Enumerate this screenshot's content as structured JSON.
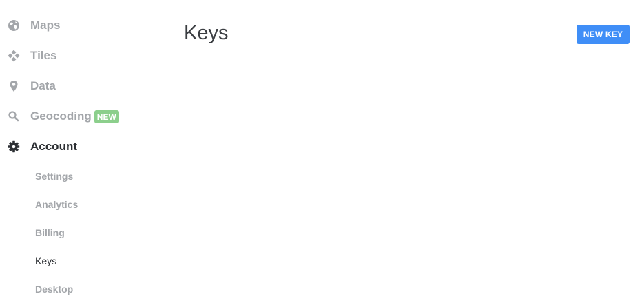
{
  "sidebar": {
    "items": [
      {
        "label": "Maps",
        "icon": "globe-icon"
      },
      {
        "label": "Tiles",
        "icon": "tiles-icon"
      },
      {
        "label": "Data",
        "icon": "map-pin-icon"
      },
      {
        "label": "Geocoding",
        "icon": "search-icon",
        "badge": "NEW"
      },
      {
        "label": "Account",
        "icon": "gear-icon",
        "active": true
      }
    ],
    "subitems": [
      {
        "label": "Settings"
      },
      {
        "label": "Analytics"
      },
      {
        "label": "Billing"
      },
      {
        "label": "Keys",
        "active": true
      },
      {
        "label": "Desktop"
      }
    ]
  },
  "main": {
    "title": "Keys",
    "new_key_label": "NEW KEY"
  },
  "colors": {
    "muted_text": "#a3a6aa",
    "active_text": "#2c2f33",
    "badge_green": "#8ccf8c",
    "button_blue": "#3f8ef7"
  }
}
